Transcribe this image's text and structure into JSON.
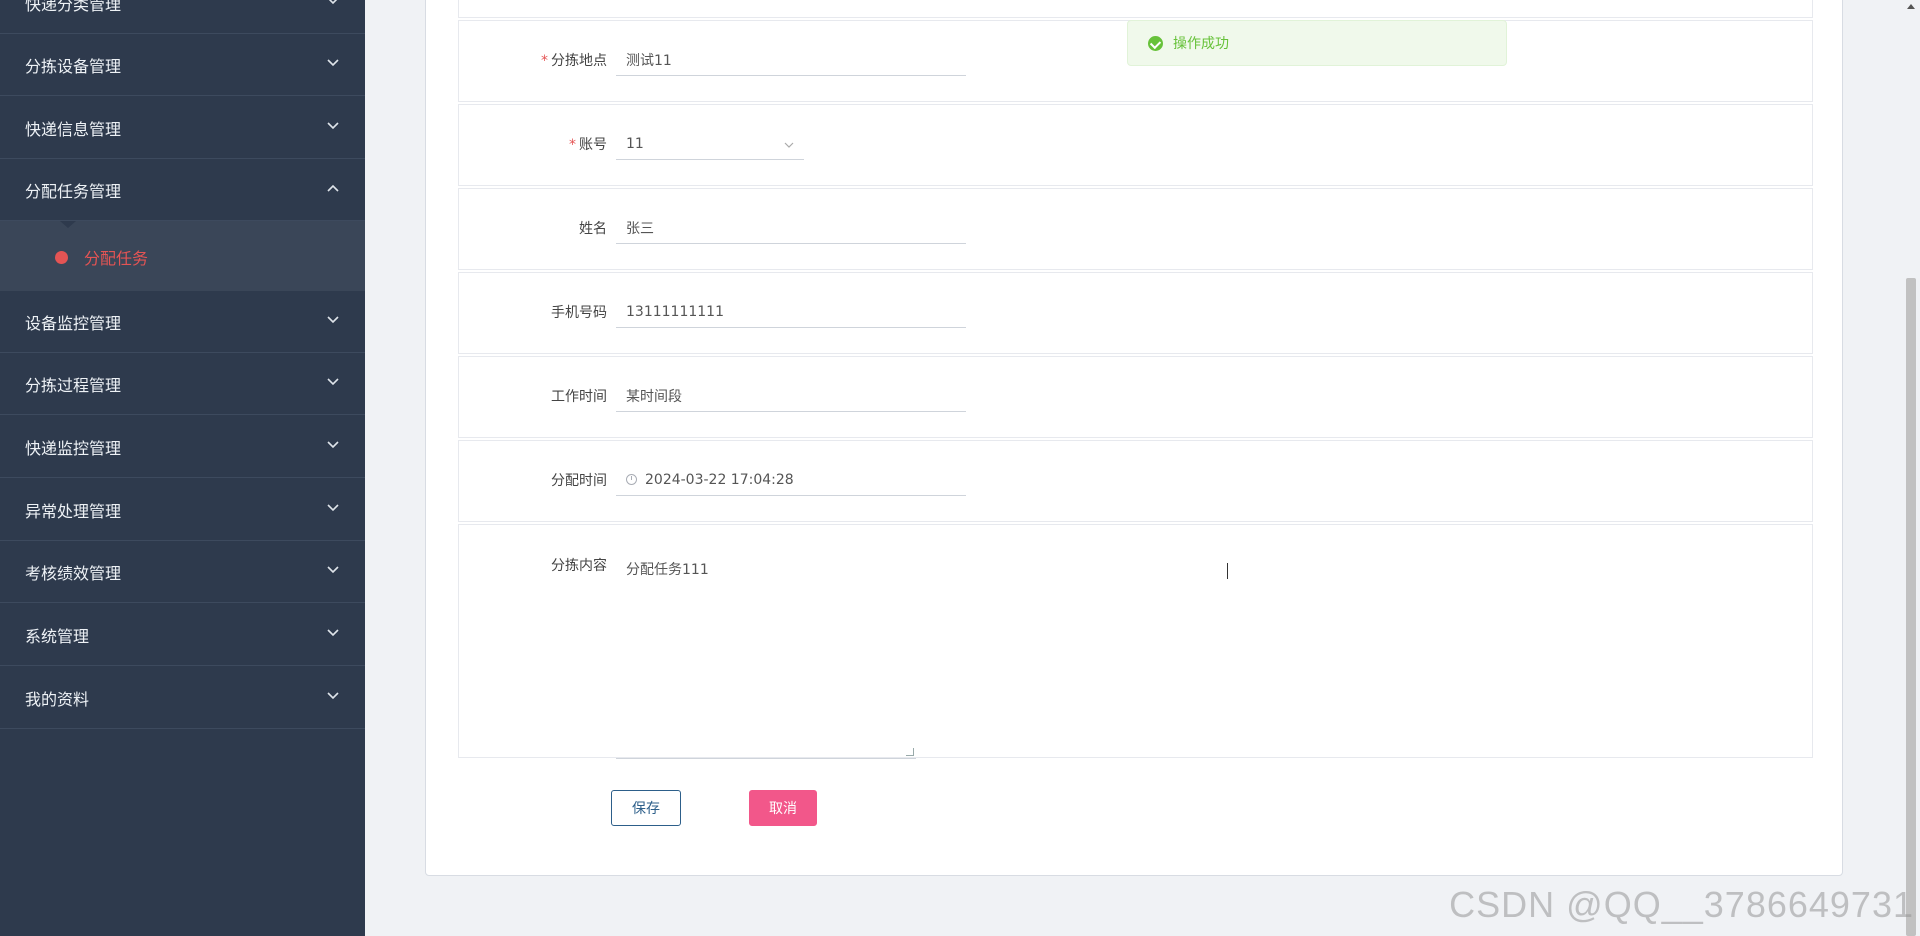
{
  "sidebar": {
    "items": [
      {
        "label": "快递分类管理"
      },
      {
        "label": "分拣设备管理"
      },
      {
        "label": "快递信息管理"
      },
      {
        "label": "分配任务管理"
      },
      {
        "label": "设备监控管理"
      },
      {
        "label": "分拣过程管理"
      },
      {
        "label": "快递监控管理"
      },
      {
        "label": "异常处理管理"
      },
      {
        "label": "考核绩效管理"
      },
      {
        "label": "系统管理"
      },
      {
        "label": "我的资料"
      }
    ],
    "submenu": {
      "label": "分配任务"
    },
    "active_color": "#e45454"
  },
  "form": {
    "location": {
      "label": "分拣地点",
      "value": "测试11"
    },
    "account": {
      "label": "账号",
      "value": "11"
    },
    "name": {
      "label": "姓名",
      "value": "张三"
    },
    "phone": {
      "label": "手机号码",
      "value": "13111111111"
    },
    "work_time": {
      "label": "工作时间",
      "value": "某时间段"
    },
    "assign_time": {
      "label": "分配时间",
      "value": "2024-03-22 17:04:28"
    },
    "content": {
      "label": "分拣内容",
      "value": "分配任务111"
    },
    "save_label": "保存",
    "cancel_label": "取消"
  },
  "toast": {
    "message": "操作成功",
    "color": "#67c23a"
  },
  "watermark": "CSDN @QQ__3786649731"
}
